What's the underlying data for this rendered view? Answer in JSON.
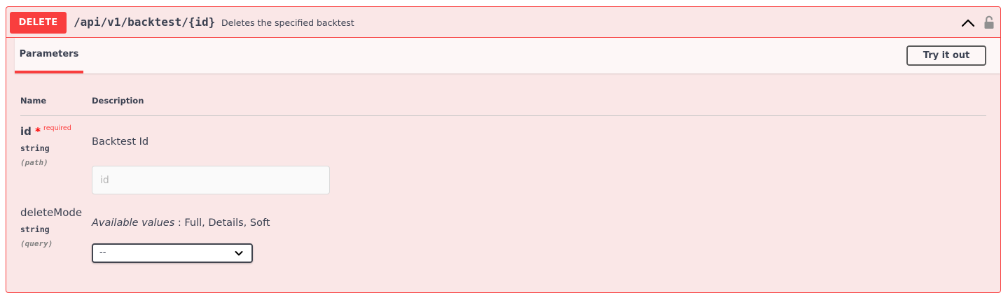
{
  "operation": {
    "method": "DELETE",
    "path": "/api/v1/backtest/{id}",
    "summary": "Deletes the specified backtest",
    "colors": {
      "method_bg": "#f93e3e",
      "block_bg": "#fae7e7",
      "border": "#f93e3e"
    },
    "icons": {
      "collapse": "chevron-up-icon",
      "auth": "unlock-icon"
    }
  },
  "tabs": {
    "parameters_label": "Parameters",
    "try_it_out_label": "Try it out"
  },
  "table": {
    "headers": {
      "name": "Name",
      "description": "Description"
    }
  },
  "parameters": [
    {
      "name": "id",
      "required_marker": "*",
      "required_label": "required",
      "type": "string",
      "in": "(path)",
      "description": "Backtest Id",
      "input_placeholder": "id"
    },
    {
      "name": "deleteMode",
      "type": "string",
      "in": "(query)",
      "available_label": "Available values",
      "available_values": ": Full, Details, Soft",
      "selected_value": "--"
    }
  ]
}
